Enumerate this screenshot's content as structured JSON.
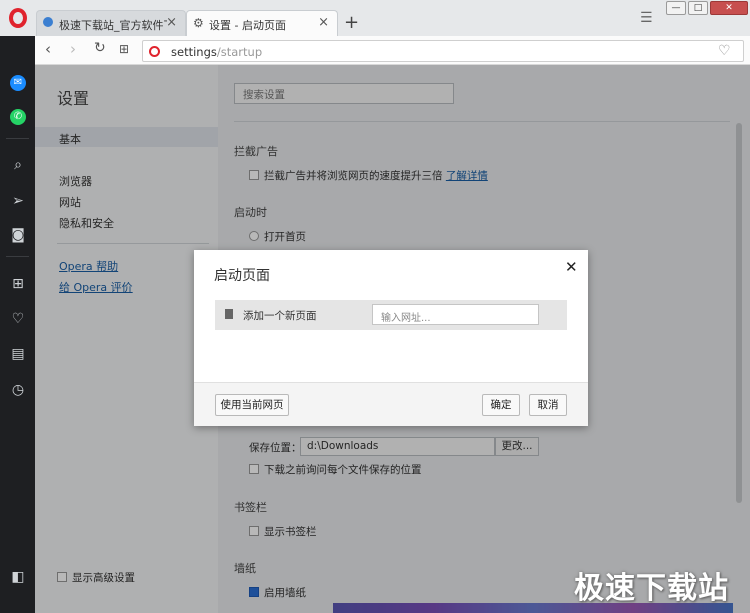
{
  "tabs": [
    {
      "label": "极速下载站_官方软件下载",
      "close": "×"
    },
    {
      "label": "设置 - 启动页面",
      "close": "×"
    }
  ],
  "newtab": "+",
  "window": {
    "minimize": "—",
    "maximize": "□",
    "close": "✕"
  },
  "address": {
    "url_host": "settings",
    "url_path": "/startup"
  },
  "left_nav": {
    "title": "设置",
    "basic": "基本",
    "items": [
      "浏览器",
      "网站",
      "隐私和安全"
    ],
    "links": [
      "Opera 帮助",
      "给 Opera 评价"
    ],
    "advanced": "显示高级设置"
  },
  "content": {
    "search_placeholder": "搜索设置",
    "adblock_title": "拦截广告",
    "adblock_option": "拦截广告并将浏览网页的速度提升三倍",
    "adblock_link": "了解详情",
    "startup_title": "启动时",
    "startup_option1": "打开首页",
    "download_label": "保存位置：",
    "download_path": "d:\\Downloads",
    "download_more": "更改...",
    "download_ask": "下载之前询问每个文件保存的位置",
    "bookmarks_title": "书签栏",
    "bookmarks_option": "显示书签栏",
    "wallpaper_title": "墙纸",
    "wallpaper_option": "启用墙纸"
  },
  "dialog": {
    "title": "启动页面",
    "close": "✕",
    "add_page": "添加一个新页面",
    "url_placeholder": "输入网址...",
    "use_current": "使用当前网页",
    "ok": "确定",
    "cancel": "取消"
  },
  "watermark": "极速下载站",
  "colors": {
    "opera_red": "#e0232d",
    "link": "#1a5fa6",
    "sidebar": "#1e1f22"
  }
}
